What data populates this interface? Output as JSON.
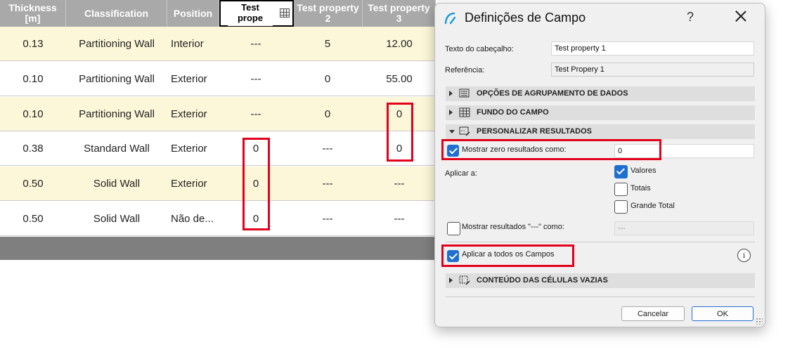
{
  "table": {
    "headers": [
      {
        "label": "Thickness [m]"
      },
      {
        "label": "Classification"
      },
      {
        "label": "Position"
      },
      {
        "label": "Test prope"
      },
      {
        "label": "Test property 2"
      },
      {
        "label": "Test property 3"
      }
    ],
    "rows": [
      {
        "thickness": "0.13",
        "classification": "Partitioning Wall",
        "position": "Interior",
        "tp1": "---",
        "tp2": "5",
        "tp3": "12.00"
      },
      {
        "thickness": "0.10",
        "classification": "Partitioning Wall",
        "position": "Exterior",
        "tp1": "---",
        "tp2": "0",
        "tp3": "55.00"
      },
      {
        "thickness": "0.10",
        "classification": "Partitioning Wall",
        "position": "Exterior",
        "tp1": "---",
        "tp2": "0",
        "tp3": "0"
      },
      {
        "thickness": "0.38",
        "classification": "Standard Wall",
        "position": "Exterior",
        "tp1": "0",
        "tp2": "---",
        "tp3": "0"
      },
      {
        "thickness": "0.50",
        "classification": "Solid Wall",
        "position": "Exterior",
        "tp1": "0",
        "tp2": "---",
        "tp3": "---"
      },
      {
        "thickness": "0.50",
        "classification": "Solid Wall",
        "position": "Não de...",
        "tp1": "0",
        "tp2": "---",
        "tp3": "---"
      }
    ]
  },
  "dialog": {
    "title": "Definições de Campo",
    "help": "?",
    "header_text_label": "Texto do cabeçalho:",
    "header_text_value": "Test property 1",
    "reference_label": "Referência:",
    "reference_value": "Test Propery 1",
    "sections": {
      "grouping": "OPÇÕES DE AGRUPAMENTO DE DADOS",
      "background": "FUNDO DO CAMPO",
      "customize": "PERSONALIZAR RESULTADOS",
      "empty_cells": "CONTEÚDO DAS CÉLULAS VAZIAS"
    },
    "show_zero_label": "Mostrar zero resultados como:",
    "show_zero_checked": true,
    "show_zero_value": "0",
    "apply_to_label": "Aplicar a:",
    "apply_options": [
      {
        "label": "Valores",
        "checked": true
      },
      {
        "label": "Totais",
        "checked": false
      },
      {
        "label": "Grande Total",
        "checked": false
      }
    ],
    "show_dash_label": "Mostrar resultados \"---\" como:",
    "show_dash_checked": false,
    "show_dash_value": "---",
    "apply_all_label": "Aplicar a todos os Campos",
    "apply_all_checked": true,
    "info_glyph": "i",
    "cancel_label": "Cancelar",
    "ok_label": "OK"
  },
  "colors": {
    "highlight_box": "#e3001b",
    "checkbox_on": "#1f6fd0",
    "header_bg": "#a9a9a9",
    "odd_row_bg": "#fdf7d9"
  }
}
